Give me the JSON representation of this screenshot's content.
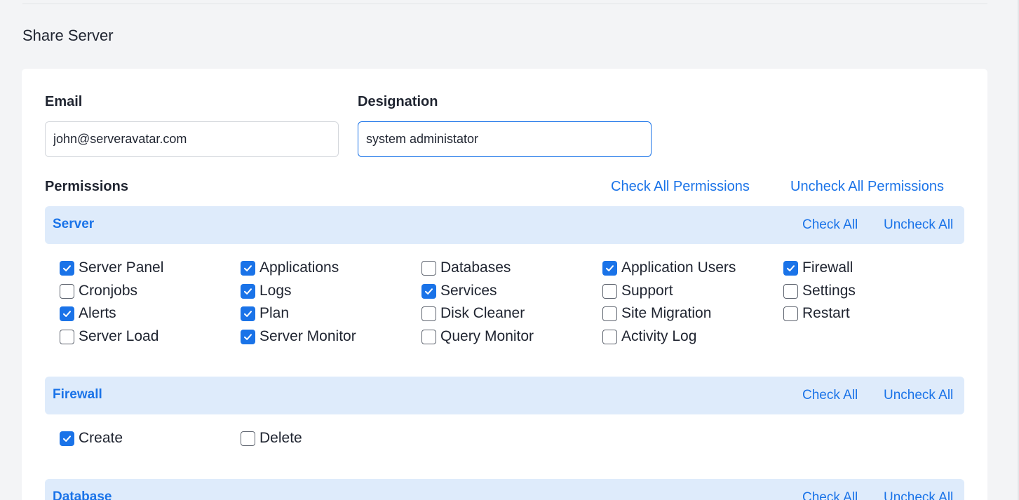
{
  "page": {
    "title": "Share Server"
  },
  "form": {
    "email_label": "Email",
    "email_value": "john@serveravatar.com",
    "designation_label": "Designation",
    "designation_value": "system administator"
  },
  "permissions": {
    "title": "Permissions",
    "check_all_label": "Check All Permissions",
    "uncheck_all_label": "Uncheck All Permissions"
  },
  "groups": [
    {
      "title": "Server",
      "check_all": "Check All",
      "uncheck_all": "Uncheck All",
      "items": [
        {
          "label": "Server Panel",
          "checked": true
        },
        {
          "label": "Applications",
          "checked": true
        },
        {
          "label": "Databases",
          "checked": false
        },
        {
          "label": "Application Users",
          "checked": true
        },
        {
          "label": "Firewall",
          "checked": true
        },
        {
          "label": "Cronjobs",
          "checked": false
        },
        {
          "label": "Logs",
          "checked": true
        },
        {
          "label": "Services",
          "checked": true
        },
        {
          "label": "Support",
          "checked": false
        },
        {
          "label": "Settings",
          "checked": false
        },
        {
          "label": "Alerts",
          "checked": true
        },
        {
          "label": "Plan",
          "checked": true
        },
        {
          "label": "Disk Cleaner",
          "checked": false
        },
        {
          "label": "Site Migration",
          "checked": false
        },
        {
          "label": "Restart",
          "checked": false
        },
        {
          "label": "Server Load",
          "checked": false
        },
        {
          "label": "Server Monitor",
          "checked": true
        },
        {
          "label": "Query Monitor",
          "checked": false
        },
        {
          "label": "Activity Log",
          "checked": false
        }
      ]
    },
    {
      "title": "Firewall",
      "check_all": "Check All",
      "uncheck_all": "Uncheck All",
      "items": [
        {
          "label": "Create",
          "checked": true
        },
        {
          "label": "Delete",
          "checked": false
        }
      ]
    },
    {
      "title": "Database",
      "check_all": "Check All",
      "uncheck_all": "Uncheck All",
      "items": []
    }
  ],
  "colors": {
    "accent": "#1a73e8",
    "group_bg": "#deebfb",
    "page_bg": "#f3f4f6"
  },
  "icons": {
    "checkbox_checked": "check-icon"
  }
}
